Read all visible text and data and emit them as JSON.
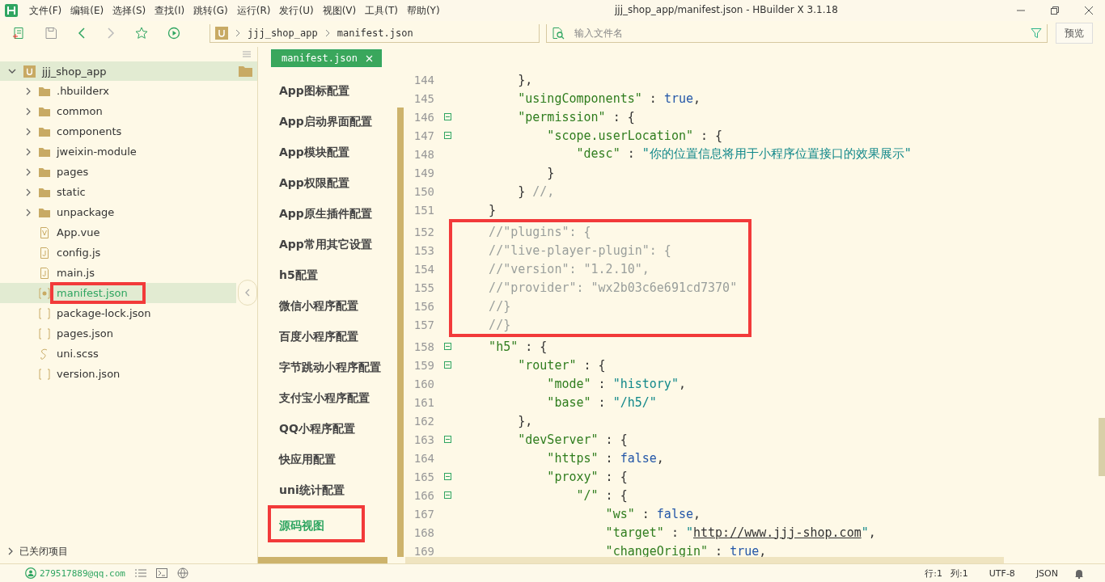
{
  "window": {
    "title": "jjj_shop_app/manifest.json - HBuilder X 3.1.18"
  },
  "menu": [
    "文件(F)",
    "编辑(E)",
    "选择(S)",
    "查找(I)",
    "跳转(G)",
    "运行(R)",
    "发行(U)",
    "视图(V)",
    "工具(T)",
    "帮助(Y)"
  ],
  "breadcrumb": [
    "jjj_shop_app",
    "manifest.json"
  ],
  "file_search": {
    "placeholder": "输入文件名"
  },
  "preview_button": "预览",
  "project": {
    "name": "jjj_shop_app",
    "expanded": true,
    "children": [
      {
        "name": ".hbuilderx",
        "kind": "folder",
        "selected": false,
        "highlighted": false
      },
      {
        "name": "common",
        "kind": "folder",
        "selected": false,
        "highlighted": false
      },
      {
        "name": "components",
        "kind": "folder",
        "selected": false,
        "highlighted": false
      },
      {
        "name": "jweixin-module",
        "kind": "folder",
        "selected": false,
        "highlighted": false
      },
      {
        "name": "pages",
        "kind": "folder",
        "selected": false,
        "highlighted": false
      },
      {
        "name": "static",
        "kind": "folder",
        "selected": false,
        "highlighted": false
      },
      {
        "name": "unpackage",
        "kind": "folder",
        "selected": false,
        "highlighted": false
      },
      {
        "name": "App.vue",
        "kind": "vue",
        "selected": false,
        "highlighted": false
      },
      {
        "name": "config.js",
        "kind": "js",
        "selected": false,
        "highlighted": false
      },
      {
        "name": "main.js",
        "kind": "js",
        "selected": false,
        "highlighted": false
      },
      {
        "name": "manifest.json",
        "kind": "config",
        "selected": true,
        "highlighted": true
      },
      {
        "name": "package-lock.json",
        "kind": "json",
        "selected": false,
        "highlighted": false
      },
      {
        "name": "pages.json",
        "kind": "json",
        "selected": false,
        "highlighted": false
      },
      {
        "name": "uni.scss",
        "kind": "style",
        "selected": false,
        "highlighted": false
      },
      {
        "name": "version.json",
        "kind": "json",
        "selected": false,
        "highlighted": false
      }
    ]
  },
  "closed_projects": {
    "label": "已关闭项目",
    "expanded": false
  },
  "tab": {
    "label": "manifest.json",
    "selected": true
  },
  "config_nav": [
    {
      "label": "App图标配置",
      "selected": false,
      "highlighted": false
    },
    {
      "label": "App启动界面配置",
      "selected": false,
      "highlighted": false
    },
    {
      "label": "App模块配置",
      "selected": false,
      "highlighted": false
    },
    {
      "label": "App权限配置",
      "selected": false,
      "highlighted": false
    },
    {
      "label": "App原生插件配置",
      "selected": false,
      "highlighted": false
    },
    {
      "label": "App常用其它设置",
      "selected": false,
      "highlighted": false
    },
    {
      "label": "h5配置",
      "selected": false,
      "highlighted": false
    },
    {
      "label": "微信小程序配置",
      "selected": false,
      "highlighted": false
    },
    {
      "label": "百度小程序配置",
      "selected": false,
      "highlighted": false
    },
    {
      "label": "字节跳动小程序配置",
      "selected": false,
      "highlighted": false
    },
    {
      "label": "支付宝小程序配置",
      "selected": false,
      "highlighted": false
    },
    {
      "label": "QQ小程序配置",
      "selected": false,
      "highlighted": false
    },
    {
      "label": "快应用配置",
      "selected": false,
      "highlighted": false
    },
    {
      "label": "uni统计配置",
      "selected": false,
      "highlighted": false
    },
    {
      "label": "源码视图",
      "selected": true,
      "highlighted": true
    }
  ],
  "code": [
    {
      "highlighted": false,
      "lines": [
        {
          "num": "144",
          "fold": false,
          "tokens": [
            {
              "kind": "p",
              "text": "        },"
            }
          ]
        },
        {
          "num": "145",
          "fold": false,
          "tokens": [
            {
              "kind": "key",
              "text": "        \"usingComponents\""
            },
            {
              "kind": "p",
              "text": " : "
            },
            {
              "kind": "bool",
              "text": "true"
            },
            {
              "kind": "p",
              "text": ","
            }
          ]
        },
        {
          "num": "146",
          "fold": true,
          "tokens": [
            {
              "kind": "key",
              "text": "        \"permission\""
            },
            {
              "kind": "p",
              "text": " : {"
            }
          ]
        },
        {
          "num": "147",
          "fold": true,
          "tokens": [
            {
              "kind": "key",
              "text": "            \"scope.userLocation\""
            },
            {
              "kind": "p",
              "text": " : {"
            }
          ]
        },
        {
          "num": "148",
          "fold": false,
          "tokens": [
            {
              "kind": "key",
              "text": "                \"desc\""
            },
            {
              "kind": "p",
              "text": " : "
            },
            {
              "kind": "str",
              "text": "\"你的位置信息将用于小程序位置接口的效果展示\""
            }
          ]
        },
        {
          "num": "149",
          "fold": false,
          "tokens": [
            {
              "kind": "p",
              "text": "            }"
            }
          ]
        },
        {
          "num": "150",
          "fold": false,
          "tokens": [
            {
              "kind": "p",
              "text": "        } "
            },
            {
              "kind": "comment",
              "text": "//,"
            }
          ]
        },
        {
          "num": "151",
          "fold": false,
          "tokens": [
            {
              "kind": "p",
              "text": "    }"
            }
          ]
        }
      ]
    },
    {
      "highlighted": true,
      "lines": [
        {
          "num": "152",
          "fold": false,
          "tokens": [
            {
              "kind": "comment",
              "text": "    //\"plugins\": {"
            }
          ]
        },
        {
          "num": "153",
          "fold": false,
          "tokens": [
            {
              "kind": "comment",
              "text": "    //\"live-player-plugin\": {"
            }
          ]
        },
        {
          "num": "154",
          "fold": false,
          "tokens": [
            {
              "kind": "comment",
              "text": "    //\"version\": \"1.2.10\","
            }
          ]
        },
        {
          "num": "155",
          "fold": false,
          "tokens": [
            {
              "kind": "comment",
              "text": "    //\"provider\": \"wx2b03c6e691cd7370\""
            }
          ]
        },
        {
          "num": "156",
          "fold": false,
          "tokens": [
            {
              "kind": "comment",
              "text": "    //}"
            }
          ]
        },
        {
          "num": "157",
          "fold": false,
          "tokens": [
            {
              "kind": "comment",
              "text": "    //}"
            }
          ]
        }
      ]
    },
    {
      "highlighted": false,
      "lines": [
        {
          "num": "158",
          "fold": true,
          "tokens": [
            {
              "kind": "key",
              "text": "    \"h5\""
            },
            {
              "kind": "p",
              "text": " : {"
            }
          ]
        },
        {
          "num": "159",
          "fold": true,
          "tokens": [
            {
              "kind": "key",
              "text": "        \"router\""
            },
            {
              "kind": "p",
              "text": " : {"
            }
          ]
        },
        {
          "num": "160",
          "fold": false,
          "tokens": [
            {
              "kind": "key",
              "text": "            \"mode\""
            },
            {
              "kind": "p",
              "text": " : "
            },
            {
              "kind": "str",
              "text": "\"history\""
            },
            {
              "kind": "p",
              "text": ","
            }
          ]
        },
        {
          "num": "161",
          "fold": false,
          "tokens": [
            {
              "kind": "key",
              "text": "            \"base\""
            },
            {
              "kind": "p",
              "text": " : "
            },
            {
              "kind": "str",
              "text": "\"/h5/\""
            }
          ]
        },
        {
          "num": "162",
          "fold": false,
          "tokens": [
            {
              "kind": "p",
              "text": "        },"
            }
          ]
        },
        {
          "num": "163",
          "fold": true,
          "tokens": [
            {
              "kind": "key",
              "text": "        \"devServer\""
            },
            {
              "kind": "p",
              "text": " : {"
            }
          ]
        },
        {
          "num": "164",
          "fold": false,
          "tokens": [
            {
              "kind": "key",
              "text": "            \"https\""
            },
            {
              "kind": "p",
              "text": " : "
            },
            {
              "kind": "bool",
              "text": "false"
            },
            {
              "kind": "p",
              "text": ","
            }
          ]
        },
        {
          "num": "165",
          "fold": true,
          "tokens": [
            {
              "kind": "key",
              "text": "            \"proxy\""
            },
            {
              "kind": "p",
              "text": " : {"
            }
          ]
        },
        {
          "num": "166",
          "fold": true,
          "tokens": [
            {
              "kind": "key",
              "text": "                \"/\""
            },
            {
              "kind": "p",
              "text": " : {"
            }
          ]
        },
        {
          "num": "167",
          "fold": false,
          "tokens": [
            {
              "kind": "key",
              "text": "                    \"ws\""
            },
            {
              "kind": "p",
              "text": " : "
            },
            {
              "kind": "bool",
              "text": "false"
            },
            {
              "kind": "p",
              "text": ","
            }
          ]
        },
        {
          "num": "168",
          "fold": false,
          "tokens": [
            {
              "kind": "key",
              "text": "                    \"target\""
            },
            {
              "kind": "p",
              "text": " : "
            },
            {
              "kind": "str",
              "text": "\""
            },
            {
              "kind": "link",
              "text": "http://www.jjj-shop.com"
            },
            {
              "kind": "str",
              "text": "\""
            },
            {
              "kind": "p",
              "text": ","
            }
          ]
        },
        {
          "num": "169",
          "fold": false,
          "tokens": [
            {
              "kind": "key",
              "text": "                    \"changeOrigin\""
            },
            {
              "kind": "p",
              "text": " : "
            },
            {
              "kind": "bool",
              "text": "true"
            },
            {
              "kind": "p",
              "text": ","
            }
          ]
        }
      ]
    }
  ],
  "status_bar": {
    "account": "279517889@qq.com",
    "position": [
      "行:1",
      "列:1"
    ],
    "encoding": "UTF-8",
    "language": "JSON"
  }
}
